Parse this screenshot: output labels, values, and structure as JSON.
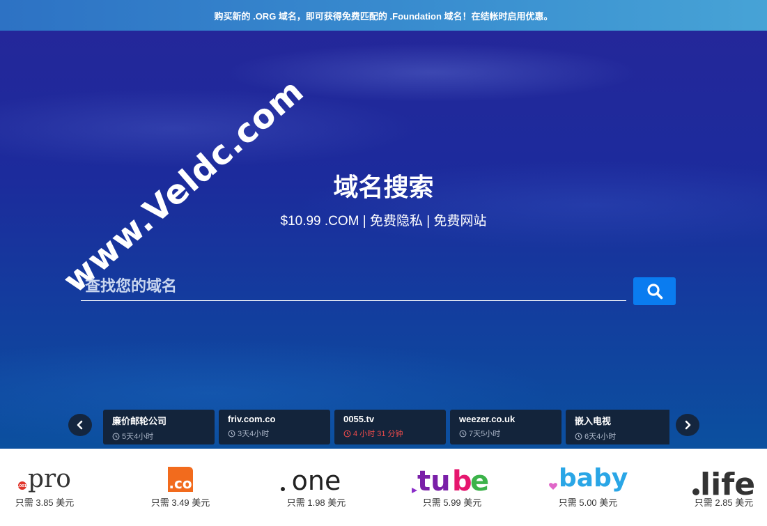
{
  "promo": {
    "text": "购买新的 .ORG 域名，即可获得免费匹配的 .Foundation 域名！在结帐时启用优惠。"
  },
  "watermark": {
    "text": "www.Veldc.com"
  },
  "hero": {
    "title": "域名搜索",
    "subtitle": "$10.99 .COM | 免费隐私 | 免费网站"
  },
  "search": {
    "placeholder": "查找您的域名",
    "value": "",
    "button_icon": "search-icon"
  },
  "auctions": [
    {
      "name": "廉价邮轮公司",
      "time": "5天4小时",
      "urgent": false
    },
    {
      "name": "friv.com.co",
      "time": "3天4小时",
      "urgent": false
    },
    {
      "name": "0055.tv",
      "time": "4 小时 31 分钟",
      "urgent": true
    },
    {
      "name": "weezer.co.uk",
      "time": "7天5小时",
      "urgent": false
    },
    {
      "name": "嵌入电视",
      "time": "6天4小时",
      "urgent": false
    }
  ],
  "tlds": [
    {
      "tld": ".pro",
      "price": "只需 3.85 美元"
    },
    {
      "tld": ".co",
      "price": "只需 3.49 美元"
    },
    {
      "tld": ".one",
      "price": "只需 1.98 美元"
    },
    {
      "tld": ".tube",
      "price": "只需 5.99 美元"
    },
    {
      "tld": ".baby",
      "price": "只需 5.00 美元"
    },
    {
      "tld": ".life",
      "price": "只需 2.85 美元"
    }
  ],
  "colors": {
    "promo_bg": "#3a8fd0",
    "hero_bg": "#1c2b9c",
    "search_button": "#0a7cf0",
    "card_bg": "#13243b",
    "urgent": "#ee4b4b"
  }
}
